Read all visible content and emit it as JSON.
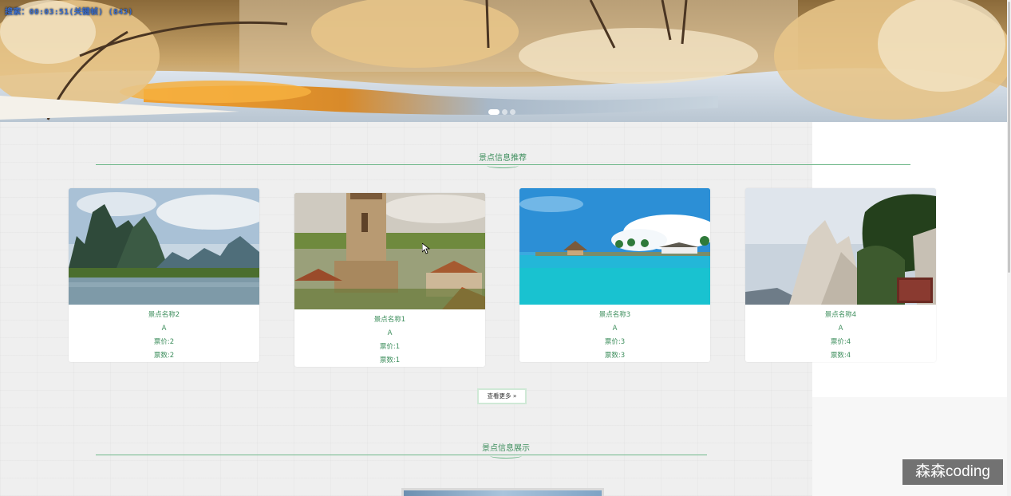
{
  "banner": {
    "status_text": "搜索：00:03:51(关键帧) (843)",
    "slides": 3,
    "active_slide": 1
  },
  "recommend": {
    "title": "景点信息推荐",
    "cards": [
      {
        "name": "景点名称2",
        "level": "A",
        "price": "票价:2",
        "count": "票数:2",
        "scene": "karst-river"
      },
      {
        "name": "景点名称1",
        "level": "A",
        "price": "票价:1",
        "count": "票数:1",
        "scene": "church-village"
      },
      {
        "name": "景点名称3",
        "level": "A",
        "price": "票价:3",
        "count": "票数:3",
        "scene": "tropical-lagoon"
      },
      {
        "name": "景点名称4",
        "level": "A",
        "price": "票价:4",
        "count": "票数:4",
        "scene": "cliff-pines"
      }
    ],
    "more_label": "查看更多 »"
  },
  "showcase": {
    "title": "景点信息展示"
  },
  "watermark": "森森coding",
  "colors": {
    "accent": "#3f8f5e",
    "line": "#6fb88a",
    "page_bg": "#efefef"
  }
}
